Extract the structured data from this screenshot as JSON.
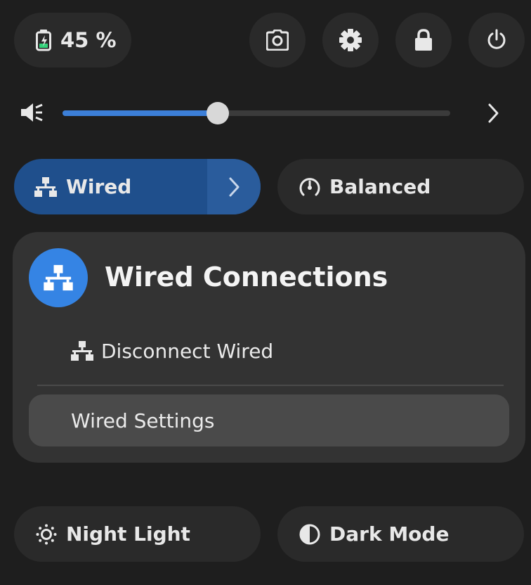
{
  "battery": {
    "label": "45 %",
    "icon": "battery-charging-icon"
  },
  "system_buttons": [
    {
      "name": "screenshot-button",
      "icon": "camera-icon"
    },
    {
      "name": "settings-button",
      "icon": "gear-icon"
    },
    {
      "name": "lock-button",
      "icon": "lock-icon"
    },
    {
      "name": "power-button",
      "icon": "power-icon"
    }
  ],
  "volume": {
    "level": 0.4,
    "icon": "speaker-muted-icon",
    "expand_icon": "chevron-right-icon"
  },
  "toggles": {
    "wired": {
      "label": "Wired",
      "icon": "network-wired-icon",
      "active": true
    },
    "power_mode": {
      "label": "Balanced",
      "icon": "speedometer-icon"
    },
    "night_light": {
      "label": "Night Light",
      "icon": "sun-icon"
    },
    "dark_mode": {
      "label": "Dark Mode",
      "icon": "contrast-icon"
    }
  },
  "wired_menu": {
    "title": "Wired Connections",
    "items": [
      {
        "label": "Disconnect Wired",
        "icon": "network-wired-icon"
      },
      {
        "label": "Wired Settings"
      }
    ]
  },
  "colors": {
    "panel_bg": "#1e1e1e",
    "button_bg": "#2a2a2a",
    "accent": "#3584e4",
    "active_toggle": "#1f4f8c",
    "menu_bg": "#333333"
  }
}
